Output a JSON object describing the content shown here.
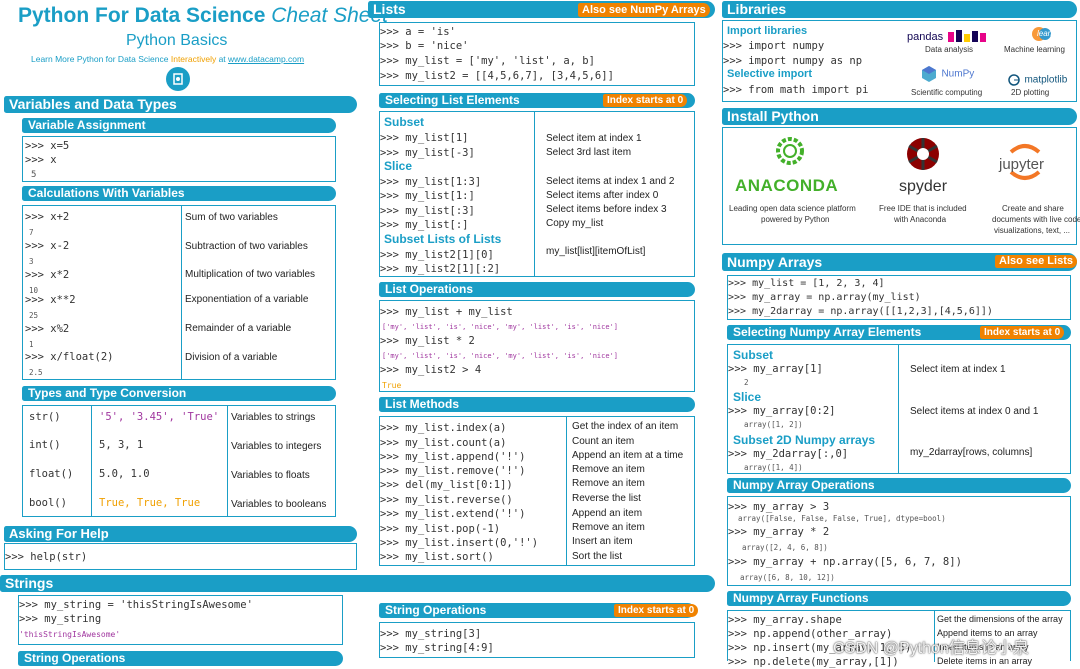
{
  "title": {
    "main": "Python For Data Science",
    "italic": "Cheat Sheet",
    "subtitle": "Python Basics",
    "learn_prefix": "Learn More Python for Data Science ",
    "learn_hl": "Interactively",
    "learn_at": " at ",
    "learn_url": "www.datacamp.com"
  },
  "sections": {
    "vars": "Variables and Data Types",
    "var_assign": "Variable Assignment",
    "calc": "Calculations With Variables",
    "types": "Types and Type Conversion",
    "help": "Asking For Help",
    "strings": "Strings",
    "string_ops": "String Operations",
    "lists": "Lists",
    "lists_badge": "Also see NumPy Arrays",
    "select_list": "Selecting List Elements",
    "index_badge": "Index starts at 0",
    "list_ops": "List Operations",
    "list_methods": "List Methods",
    "string_ops2": "String Operations",
    "libraries": "Libraries",
    "install": "Install Python",
    "numpy": "Numpy Arrays",
    "numpy_badge": "Also see Lists",
    "select_np": "Selecting Numpy Array Elements",
    "np_ops": "Numpy Array Operations",
    "np_funcs": "Numpy Array Functions"
  },
  "var_assign": [
    ">>> x=5",
    ">>> x",
    "5"
  ],
  "calc": [
    {
      "code": ">>> x+2",
      "out": "7",
      "desc": "Sum of two variables"
    },
    {
      "code": ">>> x-2",
      "out": "3",
      "desc": "Subtraction of two variables"
    },
    {
      "code": ">>> x*2",
      "out": "10",
      "desc": "Multiplication of two variables"
    },
    {
      "code": ">>> x**2",
      "out": "25",
      "desc": "Exponentiation of a variable"
    },
    {
      "code": ">>> x%2",
      "out": "1",
      "desc": "Remainder of a variable"
    },
    {
      "code": ">>> x/float(2)",
      "out": "2.5",
      "desc": "Division of a variable"
    }
  ],
  "types": [
    {
      "fn": "str()",
      "vals": "'5', '3.45', 'True'",
      "desc": "Variables to strings"
    },
    {
      "fn": "int()",
      "vals": "5, 3, 1",
      "desc": "Variables to integers"
    },
    {
      "fn": "float()",
      "vals": "5.0, 1.0",
      "desc": "Variables to floats"
    },
    {
      "fn": "bool()",
      "vals": "True, True, True",
      "desc": "Variables to booleans"
    }
  ],
  "help_code": ">>> help(str)",
  "strings_code": [
    ">>> my_string = 'thisStringIsAwesome'",
    ">>> my_string",
    "'thisStringIsAwesome'"
  ],
  "strings_ops_left": "String Operations",
  "lists_code": [
    ">>> a = 'is'",
    ">>> b = 'nice'",
    ">>> my_list = ['my', 'list', a, b]",
    ">>> my_list2 = [[4,5,6,7], [3,4,5,6]]"
  ],
  "select_list": {
    "subset": "Subset",
    "slice": "Slice",
    "subsetlists": "Subset Lists of Lists",
    "rows": [
      {
        "code": ">>> my_list[1]",
        "desc": "Select item at index 1"
      },
      {
        "code": ">>> my_list[-3]",
        "desc": "Select 3rd last item"
      },
      {
        "code": ">>> my_list[1:3]",
        "desc": "Select items at index 1 and 2"
      },
      {
        "code": ">>> my_list[1:]",
        "desc": "Select items after index 0"
      },
      {
        "code": ">>> my_list[:3]",
        "desc": "Select items before index 3"
      },
      {
        "code": ">>> my_list[:]",
        "desc": "Copy my_list"
      },
      {
        "code": ">>> my_list2[1][0]",
        "desc": "my_list[list][itemOfList]"
      },
      {
        "code": ">>> my_list2[1][:2]",
        "desc": ""
      }
    ]
  },
  "list_ops": [
    ">>> my_list + my_list",
    "['my', 'list', 'is', 'nice', 'my', 'list', 'is', 'nice']",
    ">>> my_list * 2",
    "['my', 'list', 'is', 'nice', 'my', 'list', 'is', 'nice']",
    ">>> my_list2 > 4",
    "True"
  ],
  "list_methods": [
    {
      "code": ">>> my_list.index(a)",
      "desc": "Get the index of an item"
    },
    {
      "code": ">>> my_list.count(a)",
      "desc": "Count an item"
    },
    {
      "code": ">>> my_list.append('!')",
      "desc": "Append an item at a time"
    },
    {
      "code": ">>> my_list.remove('!')",
      "desc": "Remove an item"
    },
    {
      "code": ">>> del(my_list[0:1])",
      "desc": "Remove an item"
    },
    {
      "code": ">>> my_list.reverse()",
      "desc": "Reverse the list"
    },
    {
      "code": ">>> my_list.extend('!')",
      "desc": "Append an item"
    },
    {
      "code": ">>> my_list.pop(-1)",
      "desc": "Remove an item"
    },
    {
      "code": ">>> my_list.insert(0,'!')",
      "desc": "Insert an item"
    },
    {
      "code": ">>> my_list.sort()",
      "desc": "Sort the list"
    }
  ],
  "string_ops2": [
    ">>> my_string[3]",
    ">>> my_string[4:9]"
  ],
  "libraries": {
    "import_lbl": "Import libraries",
    "import1": ">>> import numpy",
    "import2": ">>> import numpy as np",
    "selective_lbl": "Selective import",
    "selective": ">>> from math import pi",
    "logos": [
      {
        "name": "pandas",
        "caption": "Data analysis"
      },
      {
        "name": "learn",
        "caption": "Machine learning"
      },
      {
        "name": "NumPy",
        "caption": "Scientific computing"
      },
      {
        "name": "matplotlib",
        "caption": "2D plotting"
      }
    ]
  },
  "install": [
    {
      "name": "ANACONDA",
      "caption1": "Leading open data science platform",
      "caption2": "powered by Python"
    },
    {
      "name": "spyder",
      "caption1": "Free IDE that is included",
      "caption2": "with Anaconda"
    },
    {
      "name": "jupyter",
      "caption1": "Create and share",
      "caption2": "documents with live code,",
      "caption3": "visualizations, text, ..."
    }
  ],
  "numpy_code": [
    ">>> my_list = [1, 2, 3, 4]",
    ">>> my_array = np.array(my_list)",
    ">>> my_2darray = np.array([[1,2,3],[4,5,6]])"
  ],
  "select_np": {
    "subset": "Subset",
    "slice": "Slice",
    "subset2d": "Subset 2D Numpy arrays",
    "rows": [
      {
        "code": ">>> my_array[1]",
        "out": "2",
        "desc": "Select item at index 1"
      },
      {
        "code": ">>> my_array[0:2]",
        "out": "array([1, 2])",
        "desc": "Select items at index 0 and 1"
      },
      {
        "code": ">>> my_2darray[:,0]",
        "out": "array([1, 4])",
        "desc": "my_2darray[rows, columns]"
      }
    ]
  },
  "np_ops": [
    {
      "code": ">>> my_array > 3",
      "out": "array([False, False, False,  True], dtype=bool)"
    },
    {
      "code": ">>> my_array * 2",
      "out": "array([2, 4, 6, 8])"
    },
    {
      "code": ">>> my_array + np.array([5, 6, 7, 8])",
      "out": "array([6, 8, 10, 12])"
    }
  ],
  "np_funcs": [
    {
      "code": ">>> my_array.shape",
      "desc": "Get the dimensions of the array"
    },
    {
      "code": ">>> np.append(other_array)",
      "desc": "Append items to an array"
    },
    {
      "code": ">>> np.insert(my_array, 1, 5)",
      "desc": "Insert items in an array"
    },
    {
      "code": ">>> np.delete(my_array,[1])",
      "desc": "Delete items in an array"
    }
  ],
  "watermark": "CSDN @Python信息论小泉",
  "colors": {
    "accent": "#1a9ec6",
    "badge": "#f08200",
    "string": "#a0369f",
    "bool": "#f0a000"
  }
}
